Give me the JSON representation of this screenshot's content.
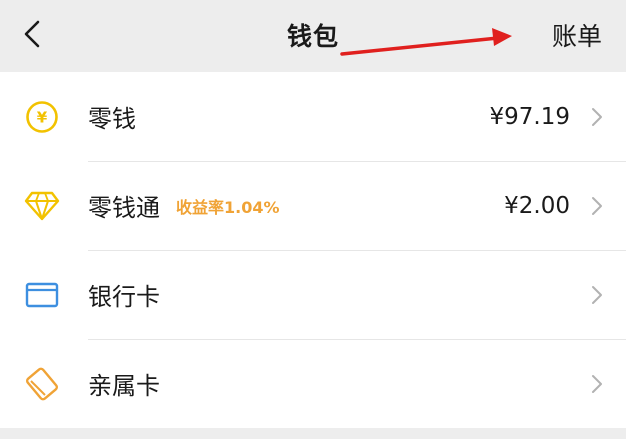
{
  "header": {
    "title": "钱包",
    "bill_label": "账单",
    "back_icon": "chevron-left-icon"
  },
  "rows": [
    {
      "label": "零钱",
      "value": "¥97.19",
      "icon": "yuan-coin-icon"
    },
    {
      "label": "零钱通",
      "badge": "收益率1.04%",
      "value": "¥2.00",
      "icon": "diamond-icon"
    },
    {
      "label": "银行卡",
      "icon": "bank-card-icon"
    },
    {
      "label": "亲属卡",
      "icon": "family-card-icon"
    }
  ],
  "colors": {
    "yellow_accent": "#f2c200",
    "badge_orange": "#f0a336",
    "card_blue": "#3d8fe0",
    "family_orange": "#f0a336",
    "annotation_red": "#e0201e"
  }
}
